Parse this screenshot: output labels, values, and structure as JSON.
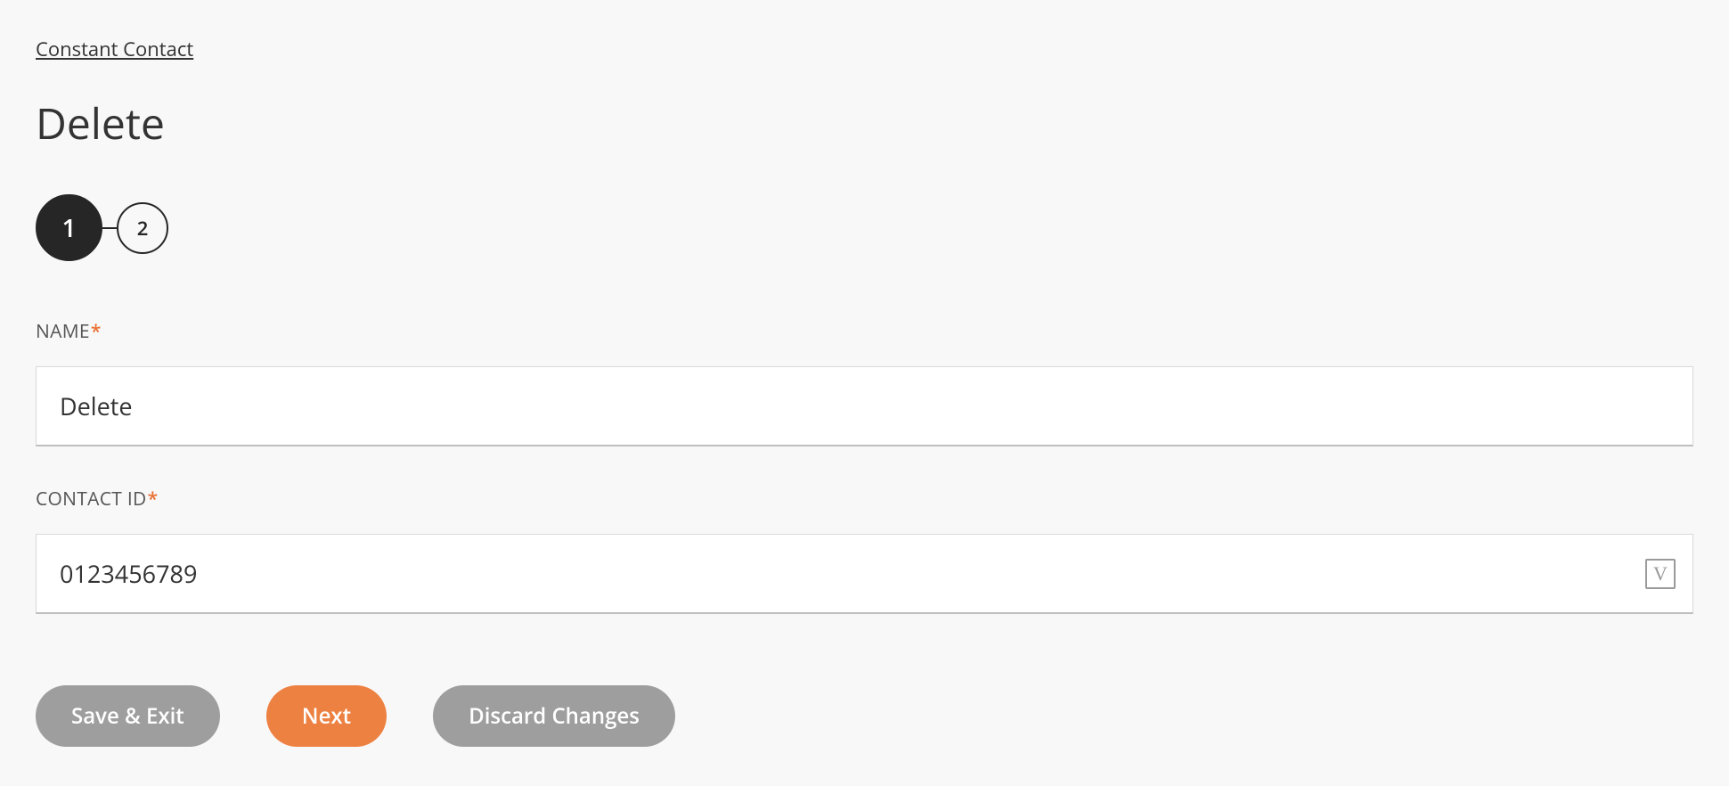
{
  "breadcrumb": {
    "text": "Constant Contact"
  },
  "title": "Delete",
  "steps": {
    "current": "1",
    "next": "2"
  },
  "fields": {
    "name": {
      "label": "NAME",
      "required": "*",
      "value": "Delete"
    },
    "contact_id": {
      "label": "CONTACT ID",
      "required": "*",
      "value": "0123456789",
      "badge": "V"
    }
  },
  "actions": {
    "save_exit": "Save & Exit",
    "next": "Next",
    "discard": "Discard Changes"
  }
}
